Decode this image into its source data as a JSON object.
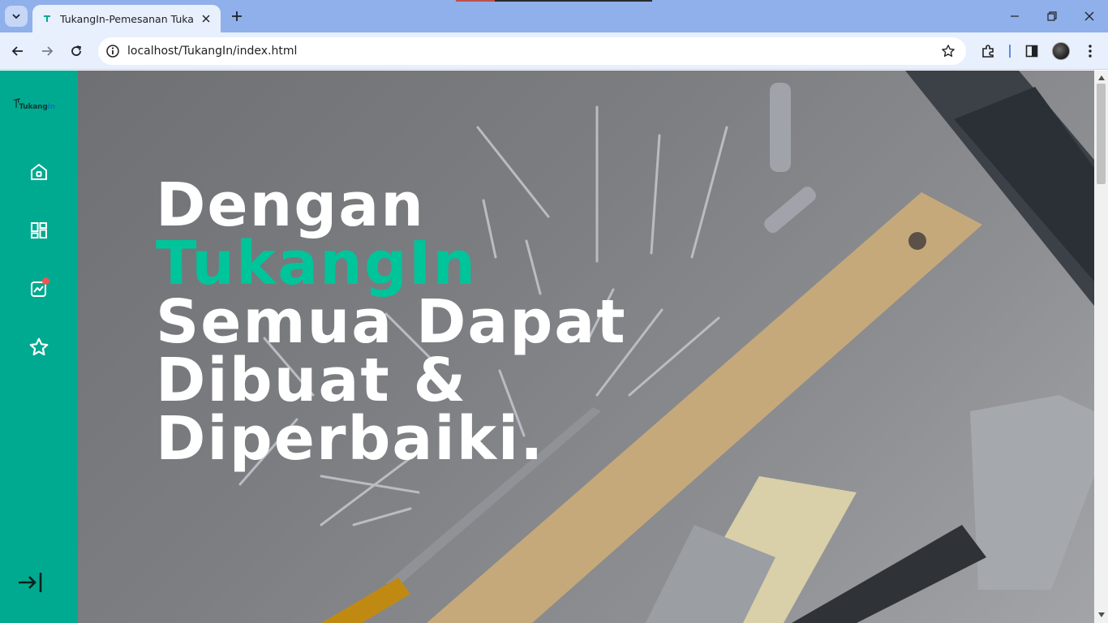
{
  "browser": {
    "tab_title": "TukangIn-Pemesanan Tukang O",
    "url": "localhost/TukangIn/index.html"
  },
  "sidebar": {
    "logo_text": "Tukang",
    "logo_accent": "In",
    "items": [
      {
        "icon": "home-icon"
      },
      {
        "icon": "dashboard-icon"
      },
      {
        "icon": "analytics-icon",
        "badge_color": "#ee5555"
      },
      {
        "icon": "star-icon"
      }
    ],
    "collapse_icon": "collapse-arrow-icon"
  },
  "hero": {
    "line1": "Dengan",
    "line2": "TukangIn",
    "line3": "Semua Dapat",
    "line4": "Dibuat &",
    "line5": "Diperbaiki."
  },
  "colors": {
    "sidebar": "#00aa90",
    "accent": "#00c49a",
    "browser_chrome": "#8fb0ea"
  }
}
